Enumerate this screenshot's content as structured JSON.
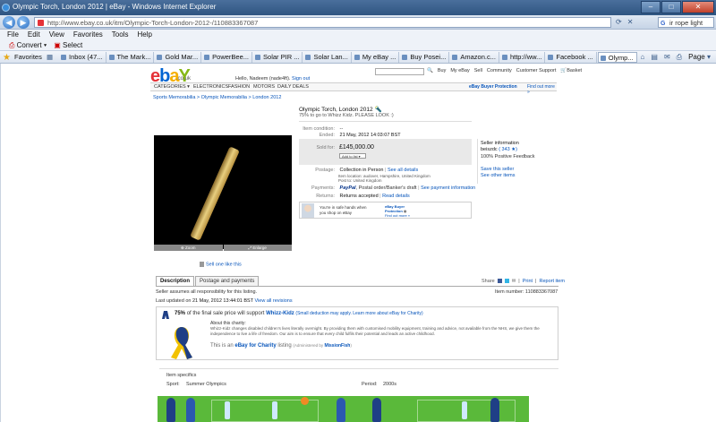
{
  "window": {
    "title": "Olympic Torch, London 2012 | eBay - Windows Internet Explorer",
    "min_label": "–",
    "max_label": "□",
    "close_label": "✕"
  },
  "browser": {
    "url": "http://www.ebay.co.uk/itm/Olympic-Torch-London-2012-/110883367087",
    "search_value": "ir rope light",
    "menu": [
      "File",
      "Edit",
      "View",
      "Favorites",
      "Tools",
      "Help"
    ],
    "toolbar": {
      "convert": "Convert",
      "select": "Select"
    },
    "favorites_label": "Favorites",
    "tabs": [
      "Inbox (47...",
      "The Mark...",
      "Gold Mar...",
      "PowerBee...",
      "Solar PIR ...",
      "Solar Lan...",
      "My eBay ...",
      "Buy Posei...",
      "Amazon.c...",
      "http://ww...",
      "Facebook ...",
      "Olymp..."
    ],
    "page_menu": "Page"
  },
  "ebay": {
    "logo_sub": ".co.uk",
    "greeting": "Hello, Nadeem (nade4ft).",
    "signout": "Sign out",
    "top_links": [
      "Buy",
      "My eBay",
      "Sell",
      "Community",
      "Customer Support"
    ],
    "basket_label": "Basket",
    "nav_tabs": [
      "CATEGORIES ▾",
      "ELECTRONICS",
      "FASHION",
      "MOTORS",
      "DAILY DEALS"
    ],
    "buyer_protection": "eBay Buyer Protection",
    "find_out_more": "Find out more »",
    "breadcrumbs": "Sports Memorabilia  >  Olympic Memorabilia  >  London 2012"
  },
  "listing": {
    "title": "Olympic Torch, London 2012",
    "subtitle": "75% to go to Whizz Kidz. PLEASE LOOK :)",
    "condition_label": "Item condition:",
    "condition_value": "--",
    "ended_label": "Ended:",
    "ended_value": "21 May, 2012 14:03:07 BST",
    "sold_label": "Sold for:",
    "sold_value": "£145,000.00",
    "add_to_list": "Add to list ▾",
    "postage_label": "Postage:",
    "postage_value": "Collection in Person",
    "see_all_details": "See all details",
    "item_location": "Item location:  audover, Hampshire, United Kingdom",
    "post_to": "Post to:  United Kingdom",
    "payments_label": "Payments:",
    "paypal": "PayPal",
    "payments_value": ", Postal order/Banker's draft",
    "see_payment_info": "See payment information",
    "returns_label": "Returns:",
    "returns_value": "Returns accepted",
    "read_details": "Read details",
    "safe_hands": "You're in safe hands when",
    "safe_hands2": "you shop on eBay",
    "bp_title": "eBay Buyer",
    "bp_title2": "Protection",
    "find_out_more": "Find out more »",
    "zoom": "⊕ Zoom",
    "enlarge": "⤢ Enlarge",
    "sell_similar": "Sell one like this"
  },
  "seller": {
    "heading": "Seller information",
    "name": "beiszdc",
    "score": "( 343 ★)",
    "feedback": "100% Positive Feedback",
    "save_seller": "Save this seller",
    "see_other": "See other items"
  },
  "description": {
    "tabs": [
      "Description",
      "Postage and payments"
    ],
    "share_label": "Share",
    "print_label": "Print",
    "report_label": "Report item",
    "responsibility": "Seller assumes all responsibility for this listing.",
    "item_number": "Item number: 110883367087",
    "last_updated_prefix": "Last updated on",
    "last_updated_date": " 21 May, 2012 13:44:01 BST ",
    "view_revisions": "View all revisions"
  },
  "charity": {
    "percent": "75%",
    "text": "of the final sale price will support",
    "org": "Whizz-Kidz",
    "small": "(Small deduction may apply. Learn more about eBay for Charity)",
    "about_label": "About this charity:",
    "about_text": "Whizz-Kidz changes disabled children's lives literally overnight. By providing them with customised mobility equipment, training and advice, not available from the NHS, we give them the independence to live a life of freedom. Our aim is to ensure that every child fulfils their potential and leads an active childhood.",
    "listing_prefix": "This is an",
    "program": "eBay for Charity",
    "listing_suffix": "listing",
    "admin": "(Administered by",
    "admin_org": "MissionFish",
    "admin_end": ")"
  },
  "specifics": {
    "heading": "Item specifics",
    "sport_label": "Sport:",
    "sport_value": "Summer Olympics",
    "period_label": "Period:",
    "period_value": "2000s"
  },
  "colors": {
    "ebay_red": "#e53238",
    "ebay_blue": "#0064d2",
    "ebay_yellow": "#f5af02",
    "ebay_green": "#86b817",
    "link_blue": "#0654ba",
    "banner_green": "#5ab93a"
  }
}
